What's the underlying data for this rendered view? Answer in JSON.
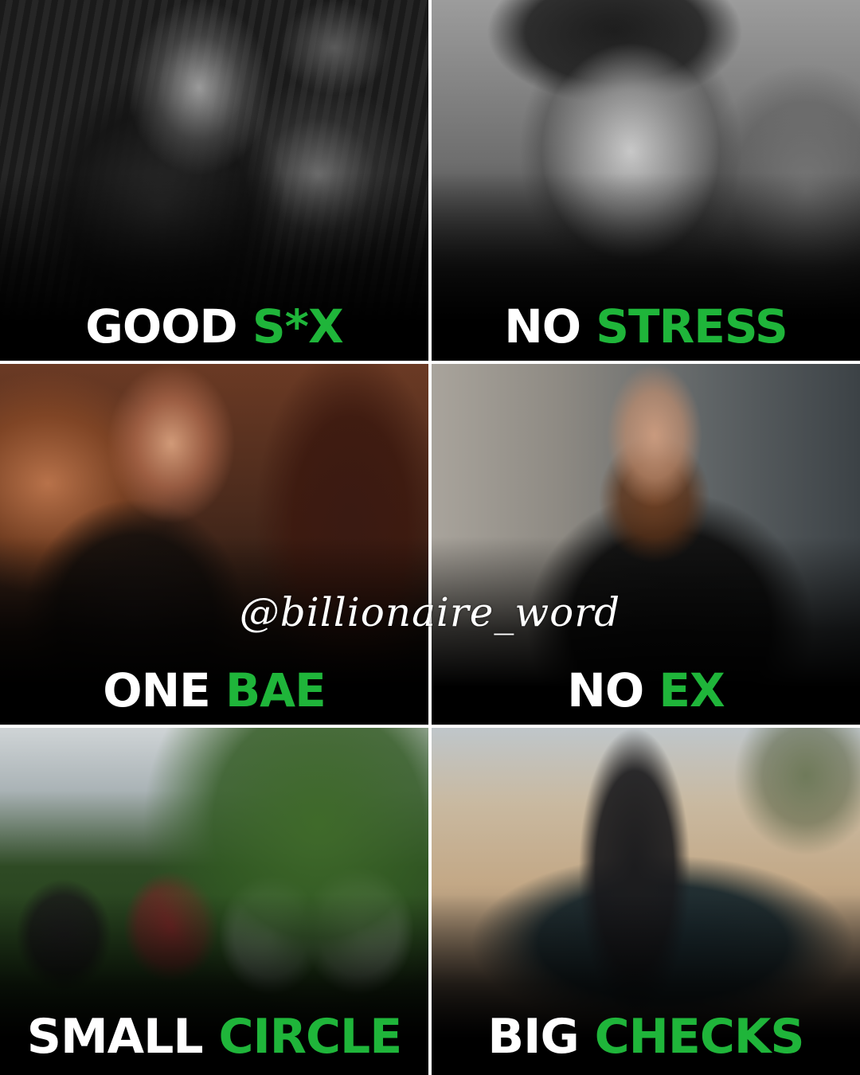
{
  "tiles": [
    {
      "id": "good-sx",
      "word1": "GOOD",
      "word2": "S*X",
      "photo": "couple-black-and-white"
    },
    {
      "id": "no-stress",
      "word1": "NO",
      "word2": "STRESS",
      "photo": "smiling-man-glasses-black-and-white"
    },
    {
      "id": "one-bae",
      "word1": "ONE",
      "word2": "BAE",
      "photo": "couple-holding-hands"
    },
    {
      "id": "no-ex",
      "word1": "NO",
      "word2": "EX",
      "photo": "bearded-man"
    },
    {
      "id": "small-circle",
      "word1": "SMALL",
      "word2": "CIRCLE",
      "photo": "friends-on-hill"
    },
    {
      "id": "big-checks",
      "word1": "BIG",
      "word2": "CHECKS",
      "photo": "man-with-luxury-car-desert"
    }
  ],
  "watermark": "@billionaire_word",
  "colors": {
    "white_text": "#ffffff",
    "green_text": "#1fb53a",
    "divider": "#ffffff",
    "background": "#000000"
  }
}
